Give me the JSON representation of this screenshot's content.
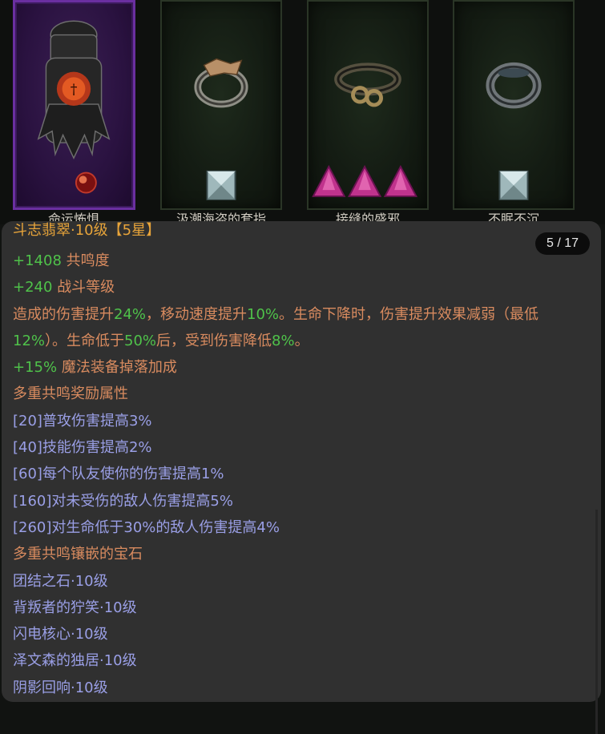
{
  "cards": [
    {
      "name": "命运怖惧",
      "rarity": "legendary",
      "gems": [
        "red-orb"
      ]
    },
    {
      "name": "汲潮海盗的套指",
      "rarity": "rare",
      "gems": [
        "diamond"
      ]
    },
    {
      "name": "接缝的盛邪",
      "rarity": "rare",
      "gems": [
        "amethyst",
        "amethyst",
        "amethyst"
      ]
    },
    {
      "name": "不眠不沉",
      "rarity": "rare",
      "gems": [
        "diamond"
      ]
    }
  ],
  "tooltip": {
    "counter": "5 / 17",
    "title": "斗志翡翠·10级【5星】",
    "stats": [
      {
        "value": "+1408",
        "label": "共鸣度"
      },
      {
        "value": "+240",
        "label": "战斗等级"
      }
    ],
    "effect": {
      "p1": "造成的伤害提升",
      "v1": "24%",
      "p2": "，移动速度提升",
      "v2": "10%",
      "p3": "。生命下降时，伤害提升效果减弱（最低",
      "v3": "12%",
      "p4": "）。生命低于",
      "v4": "50%",
      "p5": "后，受到伤害降低",
      "v5": "8%",
      "p6": "。"
    },
    "magic_find": {
      "value": "+15%",
      "label": "魔法装备掉落加成"
    },
    "bonus_header": "多重共鸣奖励属性",
    "bonuses": [
      "[20]普攻伤害提高3%",
      "[40]技能伤害提高2%",
      "[60]每个队友使你的伤害提高1%",
      "[160]对未受伤的敌人伤害提高5%",
      "[260]对生命低于30%的敌人伤害提高4%"
    ],
    "gems_header": "多重共鸣镶嵌的宝石",
    "gems": [
      "团结之石·10级",
      "背叛者的狞笑·10级",
      "闪电核心·10级",
      "泽文森的独居·10级",
      "阴影回响·10级"
    ]
  },
  "colors": {
    "title": "#e7a43a",
    "green": "#4fc24a",
    "orange": "#d98b5f",
    "blue": "#9a9fe6",
    "panel": "#303030"
  }
}
